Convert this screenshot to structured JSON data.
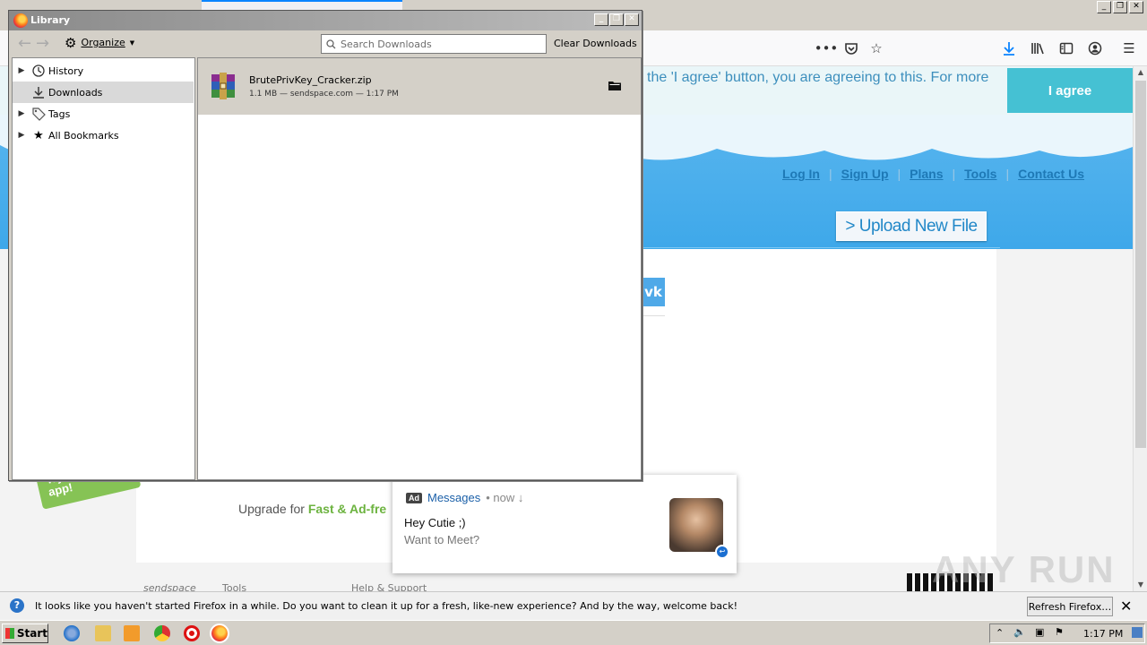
{
  "library": {
    "title": "Library",
    "organize_label": "Organize",
    "search_placeholder": "Search Downloads",
    "clear_label": "Clear Downloads",
    "sidebar": [
      {
        "label": "History"
      },
      {
        "label": "Downloads"
      },
      {
        "label": "Tags"
      },
      {
        "label": "All Bookmarks"
      }
    ],
    "download": {
      "filename": "BrutePrivKey_Cracker.zip",
      "meta": "1.1 MB — sendspace.com — 1:17 PM"
    }
  },
  "page": {
    "cookie_text": "the 'I agree' button, you are agreeing to this. For more",
    "agree_label": "I agree",
    "nav": [
      "Log In",
      "Sign Up",
      "Plans",
      "Tools",
      "Contact Us"
    ],
    "upload_label": "> Upload New File",
    "vk_label": "vk",
    "android_badge": "Try our android app!",
    "upgrade_prefix": "Upgrade for ",
    "upgrade_bold": "Fast & Ad-fre",
    "footer": [
      "sendspace",
      "Tools",
      "Help & Support"
    ]
  },
  "ad": {
    "badge": "Ad",
    "sender": "Messages",
    "time": "• now ↓",
    "title": "Hey Cutie ;)",
    "body": "Want to Meet?"
  },
  "notification": {
    "text": "It looks like you haven't started Firefox in a while. Do you want to clean it up for a fresh, like-new experience? And by the way, welcome back!",
    "button": "Refresh Firefox…"
  },
  "taskbar": {
    "start_label": "Start",
    "time": "1:17 PM"
  },
  "watermark": "ANY RUN"
}
